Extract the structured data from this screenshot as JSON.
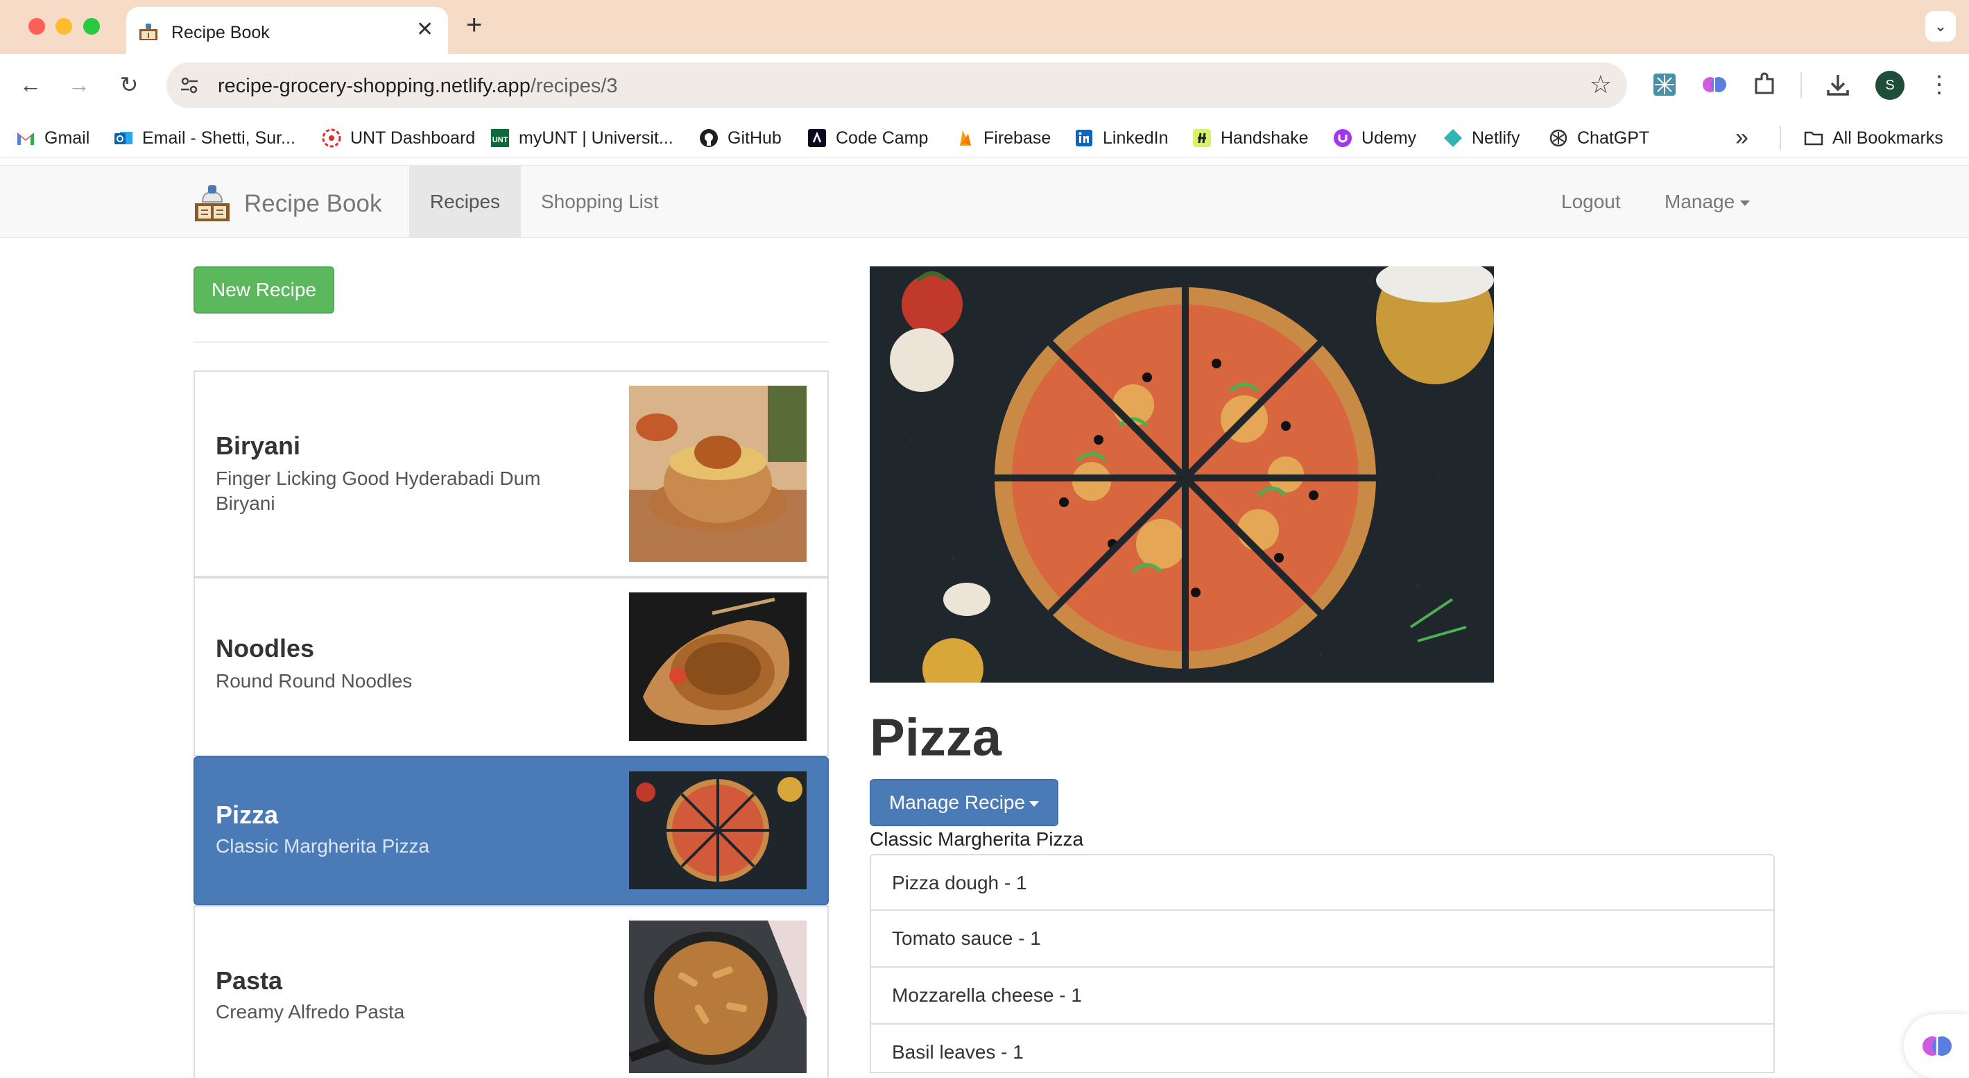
{
  "browser": {
    "tab_title": "Recipe Book",
    "tab_close": "✕",
    "new_tab": "+",
    "tab_menu": "⌄",
    "url_domain": "recipe-grocery-shopping.netlify.app",
    "url_path": "/recipes/3",
    "profile_initial": "S",
    "bookmarks": [
      {
        "label": "Gmail",
        "icon": "gmail-icon"
      },
      {
        "label": "Email - Shetti, Sur...",
        "icon": "outlook-icon"
      },
      {
        "label": "UNT Dashboard",
        "icon": "unt-dashboard-icon"
      },
      {
        "label": "myUNT | Universit...",
        "icon": "myunt-icon"
      },
      {
        "label": "GitHub",
        "icon": "github-icon"
      },
      {
        "label": "Code Camp",
        "icon": "code-camp-icon"
      },
      {
        "label": "Firebase",
        "icon": "firebase-icon"
      },
      {
        "label": "LinkedIn",
        "icon": "linkedin-icon"
      },
      {
        "label": "Handshake",
        "icon": "handshake-icon"
      },
      {
        "label": "Udemy",
        "icon": "udemy-icon"
      },
      {
        "label": "Netlify",
        "icon": "netlify-icon"
      },
      {
        "label": "ChatGPT",
        "icon": "chatgpt-icon"
      }
    ],
    "bookmarks_more": "»",
    "all_bookmarks": "All Bookmarks"
  },
  "app": {
    "brand": "Recipe Book",
    "nav": {
      "recipes": "Recipes",
      "shopping_list": "Shopping List",
      "logout": "Logout",
      "manage": "Manage"
    },
    "new_recipe_label": "New Recipe",
    "recipes": [
      {
        "name": "Biryani",
        "description": "Finger Licking Good Hyderabadi Dum Biryani",
        "active": false
      },
      {
        "name": "Noodles",
        "description": "Round Round Noodles",
        "active": false
      },
      {
        "name": "Pizza",
        "description": "Classic Margherita Pizza",
        "active": true
      },
      {
        "name": "Pasta",
        "description": "Creamy Alfredo Pasta",
        "active": false
      }
    ],
    "detail": {
      "title": "Pizza",
      "manage_label": "Manage Recipe",
      "description": "Classic Margherita Pizza",
      "ingredients": [
        "Pizza dough - 1",
        "Tomato sauce - 1",
        "Mozzarella cheese - 1",
        "Basil leaves - 1"
      ]
    }
  },
  "colors": {
    "chrome_tab_bar": "#f6dcc6",
    "success": "#5cb85c",
    "primary": "#4a7bb7",
    "navbar": "#f8f8f8"
  }
}
